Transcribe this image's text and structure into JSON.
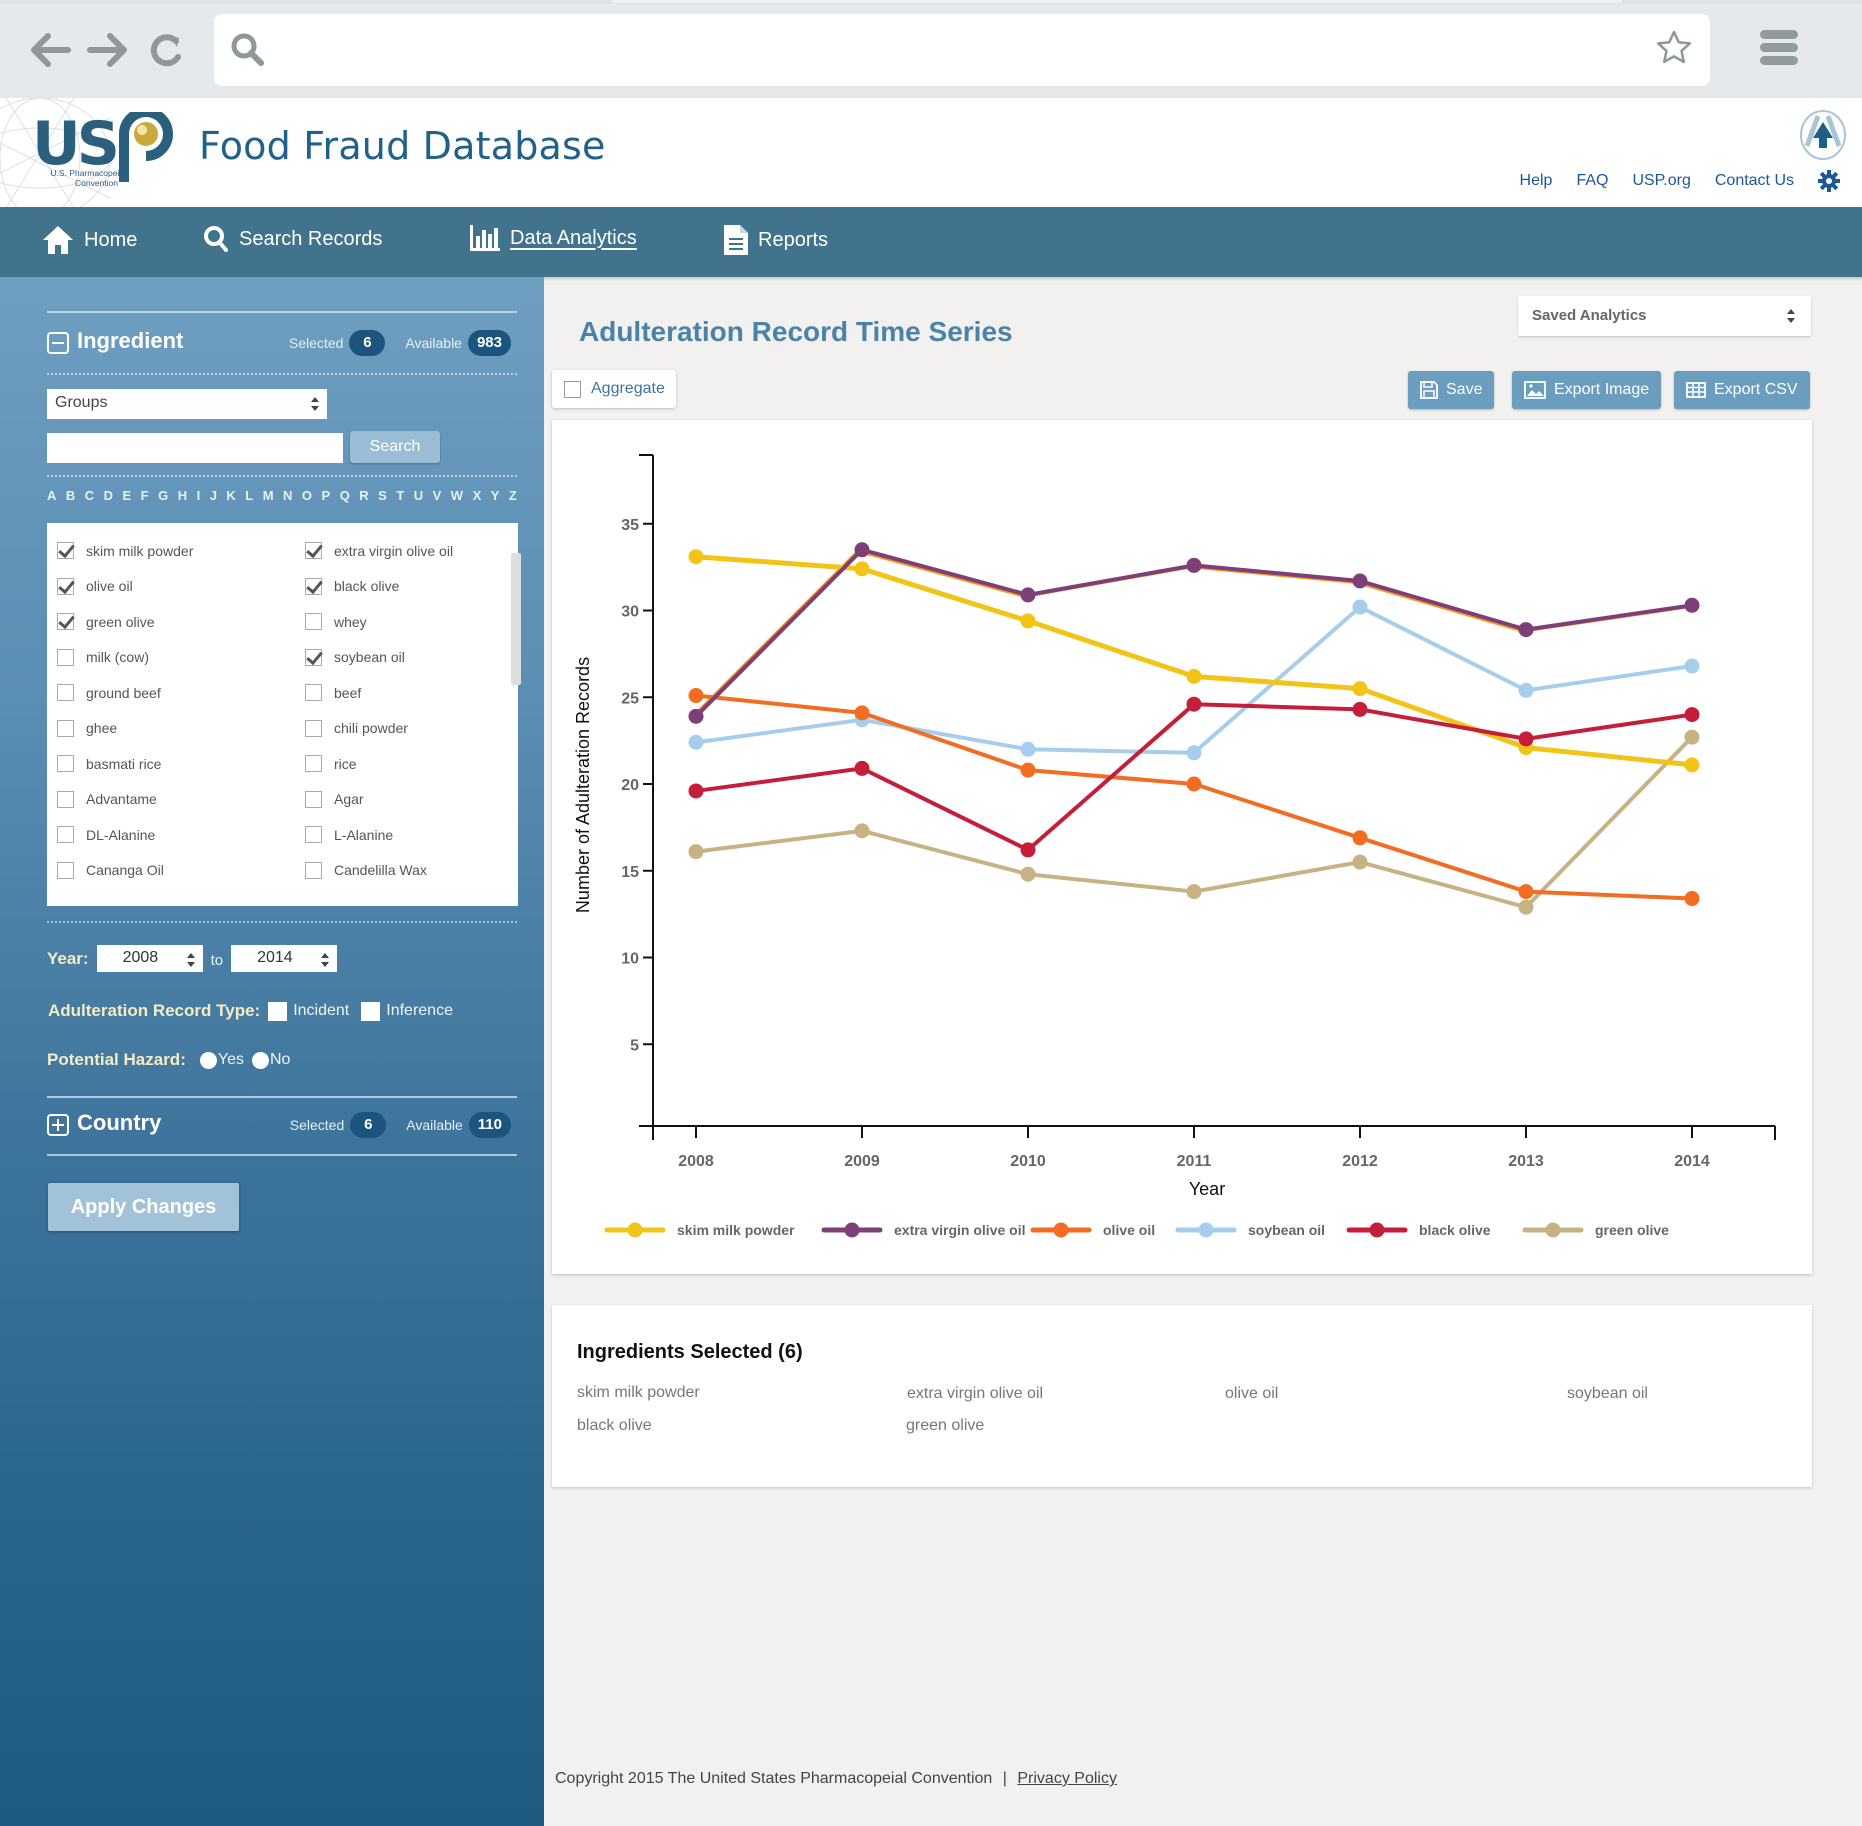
{
  "browser": {
    "url_value": "",
    "icons": [
      "back-arrow-icon",
      "forward-arrow-icon",
      "reload-icon",
      "search-icon",
      "bookmark-star-icon",
      "hamburger-menu-icon"
    ]
  },
  "header": {
    "logo_text": "USP",
    "logo_subtitle_1": "U.S. Pharmacopeial",
    "logo_subtitle_2": "Convention",
    "site_title": "Food Fraud Database",
    "links": [
      "Help",
      "FAQ",
      "USP.org",
      "Contact Us"
    ],
    "brand_color": "#1f6189"
  },
  "nav": {
    "items": [
      {
        "label": "Home",
        "icon": "home-icon",
        "active": false
      },
      {
        "label": "Search Records",
        "icon": "search-icon",
        "active": false
      },
      {
        "label": "Data Analytics",
        "icon": "bar-chart-icon",
        "active": true
      },
      {
        "label": "Reports",
        "icon": "document-icon",
        "active": false
      }
    ]
  },
  "sidebar": {
    "ingredient": {
      "title": "Ingredient",
      "selected_label": "Selected",
      "selected_count": "6",
      "available_label": "Available",
      "available_count": "983",
      "groups_value": "Groups",
      "search_value": "",
      "search_button": "Search",
      "alphabet": [
        "A",
        "B",
        "C",
        "D",
        "E",
        "F",
        "G",
        "H",
        "I",
        "J",
        "K",
        "L",
        "M",
        "N",
        "O",
        "P",
        "Q",
        "R",
        "S",
        "T",
        "U",
        "V",
        "W",
        "X",
        "Y",
        "Z"
      ],
      "items": [
        {
          "label": "skim milk powder",
          "checked": true
        },
        {
          "label": "extra virgin olive oil",
          "checked": true
        },
        {
          "label": "olive oil",
          "checked": true
        },
        {
          "label": "black olive",
          "checked": true
        },
        {
          "label": "green olive",
          "checked": true
        },
        {
          "label": "whey",
          "checked": false
        },
        {
          "label": "milk (cow)",
          "checked": false
        },
        {
          "label": "soybean oil",
          "checked": true
        },
        {
          "label": "ground beef",
          "checked": false
        },
        {
          "label": "beef",
          "checked": false
        },
        {
          "label": "ghee",
          "checked": false
        },
        {
          "label": "chili powder",
          "checked": false
        },
        {
          "label": "basmati rice",
          "checked": false
        },
        {
          "label": "rice",
          "checked": false
        },
        {
          "label": "Advantame",
          "checked": false
        },
        {
          "label": "Agar",
          "checked": false
        },
        {
          "label": "DL-Alanine",
          "checked": false
        },
        {
          "label": "L-Alanine",
          "checked": false
        },
        {
          "label": "Cananga Oil",
          "checked": false
        },
        {
          "label": "Candelilla Wax",
          "checked": false
        }
      ]
    },
    "year_label": "Year:",
    "year_from": "2008",
    "year_to_label": "to",
    "year_to": "2014",
    "record_type_label": "Adulteration Record Type:",
    "record_types": [
      "Incident",
      "Inference"
    ],
    "hazard_label": "Potential Hazard:",
    "hazard_options": [
      "Yes",
      "No"
    ],
    "country": {
      "title": "Country",
      "selected_label": "Selected",
      "selected_count": "6",
      "available_label": "Available",
      "available_count": "110"
    },
    "apply_button": "Apply Changes"
  },
  "main": {
    "title": "Adulteration Record Time Series",
    "saved_analytics": "Saved Analytics",
    "aggregate_label": "Aggregate",
    "aggregate_checked": false,
    "buttons": {
      "save": "Save",
      "export_image": "Export Image",
      "export_csv": "Export CSV"
    },
    "ingredients_selected": {
      "heading": "Ingredients Selected (6)",
      "items": [
        "skim milk powder",
        "extra virgin olive oil",
        "olive oil",
        "soybean oil",
        "black olive",
        "green olive"
      ]
    }
  },
  "chart_data": {
    "type": "line",
    "title": "Adulteration Record Time Series",
    "xlabel": "Year",
    "ylabel": "Number of Adulteration Records",
    "x": [
      2008,
      2009,
      2010,
      2011,
      2012,
      2013,
      2014
    ],
    "x_tick_labels": [
      "2008",
      "2009",
      "2010",
      "2011",
      "2012",
      "2013",
      "2014"
    ],
    "y_ticks": [
      5,
      10,
      15,
      20,
      25,
      30,
      35
    ],
    "ylim": [
      0,
      38
    ],
    "grid": false,
    "legend_position": "bottom",
    "series": [
      {
        "name": "skim milk powder",
        "color": "#f2c418",
        "values": [
          33.1,
          32.4,
          29.4,
          26.2,
          25.5,
          22.1,
          21.1
        ]
      },
      {
        "name": "extra virgin olive oil",
        "color": "#7d3f78",
        "values": [
          23.9,
          33.5,
          30.9,
          32.6,
          31.7,
          28.9,
          30.3
        ]
      },
      {
        "name": "olive oil",
        "color": "#f26c21",
        "values": [
          25.1,
          24.1,
          20.8,
          20.0,
          16.9,
          13.8,
          13.4
        ]
      },
      {
        "name": "soybean oil",
        "color": "#a6cdeb",
        "values": [
          22.4,
          23.7,
          22.0,
          21.8,
          30.2,
          25.4,
          26.8
        ]
      },
      {
        "name": "black olive",
        "color": "#c41e3a",
        "values": [
          19.6,
          20.9,
          16.2,
          24.6,
          24.3,
          22.6,
          24.0
        ]
      },
      {
        "name": "green olive",
        "color": "#c6b283",
        "values": [
          16.1,
          17.3,
          14.8,
          13.8,
          15.5,
          12.9,
          22.7
        ]
      }
    ]
  },
  "footer": {
    "copyright": "Copyright 2015 The United States Pharmacopeial Convention",
    "separator": "|",
    "privacy_link": "Privacy Policy"
  }
}
